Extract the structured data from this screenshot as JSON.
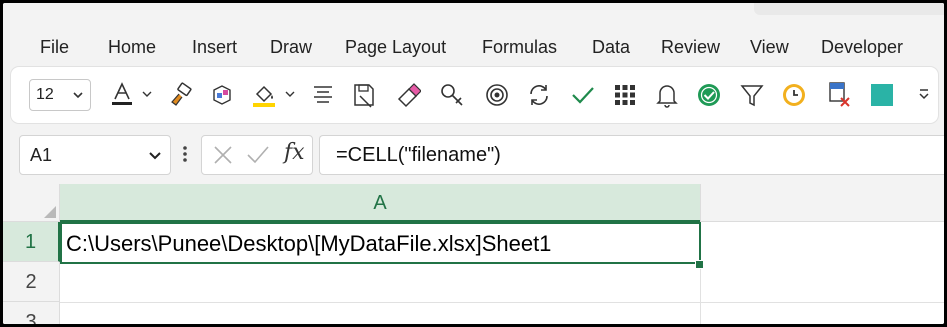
{
  "menu": {
    "items": [
      {
        "label": "File"
      },
      {
        "label": "Home"
      },
      {
        "label": "Insert"
      },
      {
        "label": "Draw"
      },
      {
        "label": "Page Layout"
      },
      {
        "label": "Formulas"
      },
      {
        "label": "Data"
      },
      {
        "label": "Review"
      },
      {
        "label": "View"
      },
      {
        "label": "Developer"
      }
    ]
  },
  "ribbon": {
    "font_size": "12",
    "icons": [
      "font-color-icon",
      "format-painter-icon",
      "3d-box-icon",
      "fill-color-icon",
      "align-icon",
      "paste-special-icon",
      "eraser-icon",
      "key-icon",
      "target-icon",
      "refresh-icon",
      "check-icon",
      "grid-icon",
      "bell-icon",
      "check-circle-icon",
      "filter-icon",
      "clock-icon",
      "remove-column-icon",
      "teal-square-icon",
      "more-icon"
    ],
    "colors": {
      "fill_highlight": "#ffd400",
      "font_underline": "#222222",
      "teal": "#2ab3a6",
      "clock": "#f2b01e"
    }
  },
  "formula_bar": {
    "name_box": "A1",
    "fx_label": "fx",
    "formula": "=CELL(\"filename\")"
  },
  "sheet": {
    "columns": [
      {
        "label": "A"
      }
    ],
    "rows": [
      {
        "label": "1"
      },
      {
        "label": "2"
      },
      {
        "label": "3"
      }
    ],
    "cells": {
      "A1": "C:\\Users\\Punee\\Desktop\\[MyDataFile.xlsx]Sheet1"
    },
    "accent": "#217346"
  }
}
